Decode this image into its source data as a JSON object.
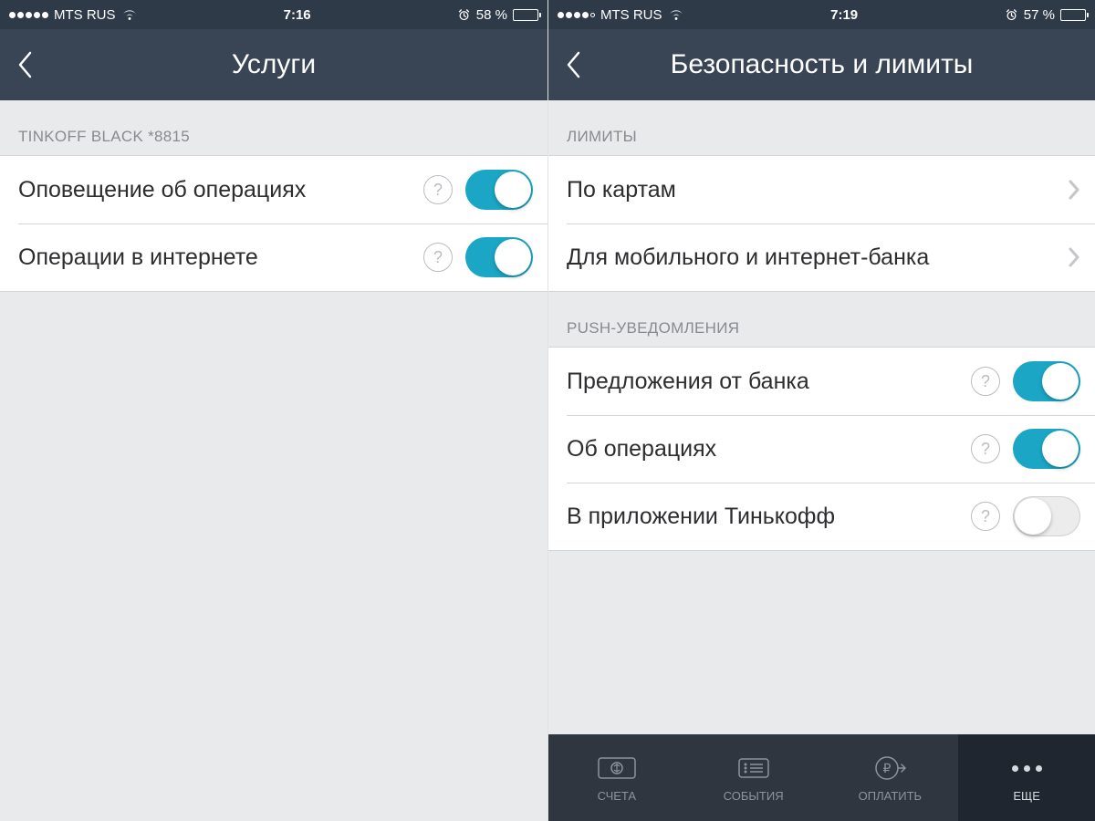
{
  "left": {
    "status": {
      "carrier": "MTS RUS",
      "time": "7:16",
      "battery_text": "58 %",
      "battery_pct": 58,
      "signal_filled": 5
    },
    "nav": {
      "title": "Услуги"
    },
    "section1": {
      "header": "TINKOFF BLACK *8815",
      "rows": [
        {
          "label": "Оповещение об операциях",
          "toggle": true
        },
        {
          "label": "Операции в интернете",
          "toggle": true
        }
      ]
    }
  },
  "right": {
    "status": {
      "carrier": "MTS RUS",
      "time": "7:19",
      "battery_text": "57 %",
      "battery_pct": 57,
      "signal_filled": 4
    },
    "nav": {
      "title": "Безопасность и лимиты"
    },
    "limits": {
      "header": "ЛИМИТЫ",
      "rows": [
        {
          "label": "По картам"
        },
        {
          "label": "Для мобильного и интернет-банка"
        }
      ]
    },
    "push": {
      "header": "PUSH-УВЕДОМЛЕНИЯ",
      "rows": [
        {
          "label": "Предложения от банка",
          "toggle": true
        },
        {
          "label": "Об операциях",
          "toggle": true
        },
        {
          "label": "В приложении Тинькофф",
          "toggle": false
        }
      ]
    },
    "tabs": [
      {
        "id": "accounts",
        "label": "СЧЕТА"
      },
      {
        "id": "events",
        "label": "СОБЫТИЯ"
      },
      {
        "id": "pay",
        "label": "ОПЛАТИТЬ"
      },
      {
        "id": "more",
        "label": "ЕЩЕ",
        "active": true
      }
    ]
  }
}
